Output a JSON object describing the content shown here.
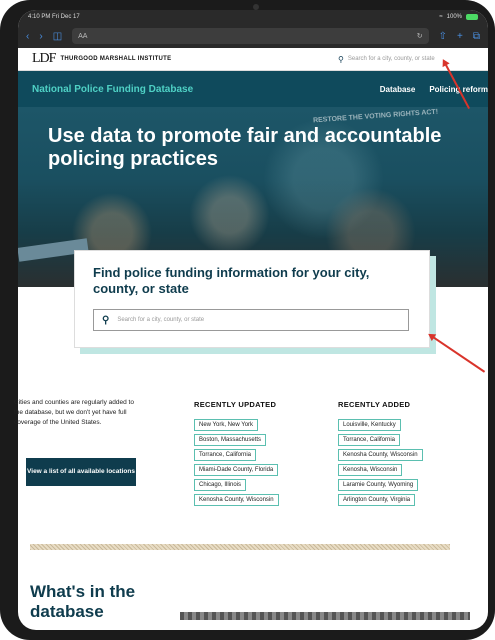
{
  "status_bar": {
    "time": "4:10 PM  Fri Dec 17",
    "battery": "100%"
  },
  "browser": {
    "url_text": "AA"
  },
  "site": {
    "logo_mark": "LDF",
    "logo_text": "THURGOOD MARSHALL INSTITUTE",
    "header_search_placeholder": "Search for a city, county, or state"
  },
  "nav": {
    "title": "National Police Funding Database",
    "links": [
      "Database",
      "Policing reform"
    ]
  },
  "hero": {
    "title": "Use data to promote fair and accountable policing practices",
    "sign_text": "RESTORE THE VOTING RIGHTS ACT!"
  },
  "find": {
    "title": "Find police funding information for your city, county, or state",
    "placeholder": "Search for a city, county, or state"
  },
  "info": {
    "text": "Cities and counties are regularly added to the database, but we don't yet have full coverage of the United States.",
    "button": "View a list of all available locations"
  },
  "recently_updated": {
    "heading": "RECENTLY UPDATED",
    "items": [
      "New York, New York",
      "Boston, Massachusetts",
      "Torrance, California",
      "Miami-Dade County, Florida",
      "Chicago, Illinois",
      "Kenosha County, Wisconsin"
    ]
  },
  "recently_added": {
    "heading": "RECENTLY ADDED",
    "items": [
      "Louisville, Kentucky",
      "Torrance, California",
      "Kenosha County, Wisconsin",
      "Kenosha, Wisconsin",
      "Laramie County, Wyoming",
      "Arlington County, Virginia"
    ]
  },
  "section": {
    "title": "What's in the database"
  },
  "colors": {
    "teal_dark": "#0f4a5c",
    "teal_accent": "#4fd1c5",
    "navy": "#0f3c4d",
    "annotation_red": "#d9342b"
  }
}
